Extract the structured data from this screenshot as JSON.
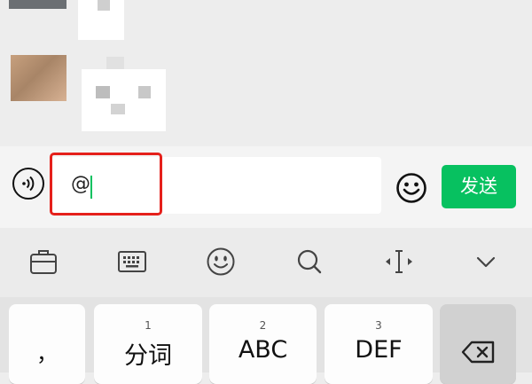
{
  "input": {
    "value": "@",
    "send_label": "发送"
  },
  "keyboard": {
    "keys": [
      {
        "num": "",
        "label": "，"
      },
      {
        "num": "1",
        "label": "分词"
      },
      {
        "num": "2",
        "label": "ABC"
      },
      {
        "num": "3",
        "label": "DEF"
      }
    ]
  },
  "colors": {
    "accent": "#07c160",
    "highlight": "#e5201b"
  },
  "icons": {
    "toolbar": [
      "briefcase-icon",
      "keyboard-icon",
      "emoji-icon",
      "search-icon",
      "cursor-move-icon",
      "chevron-down-icon"
    ],
    "input_bar": [
      "voice-icon",
      "emoji-icon"
    ],
    "delete": "backspace-icon"
  }
}
